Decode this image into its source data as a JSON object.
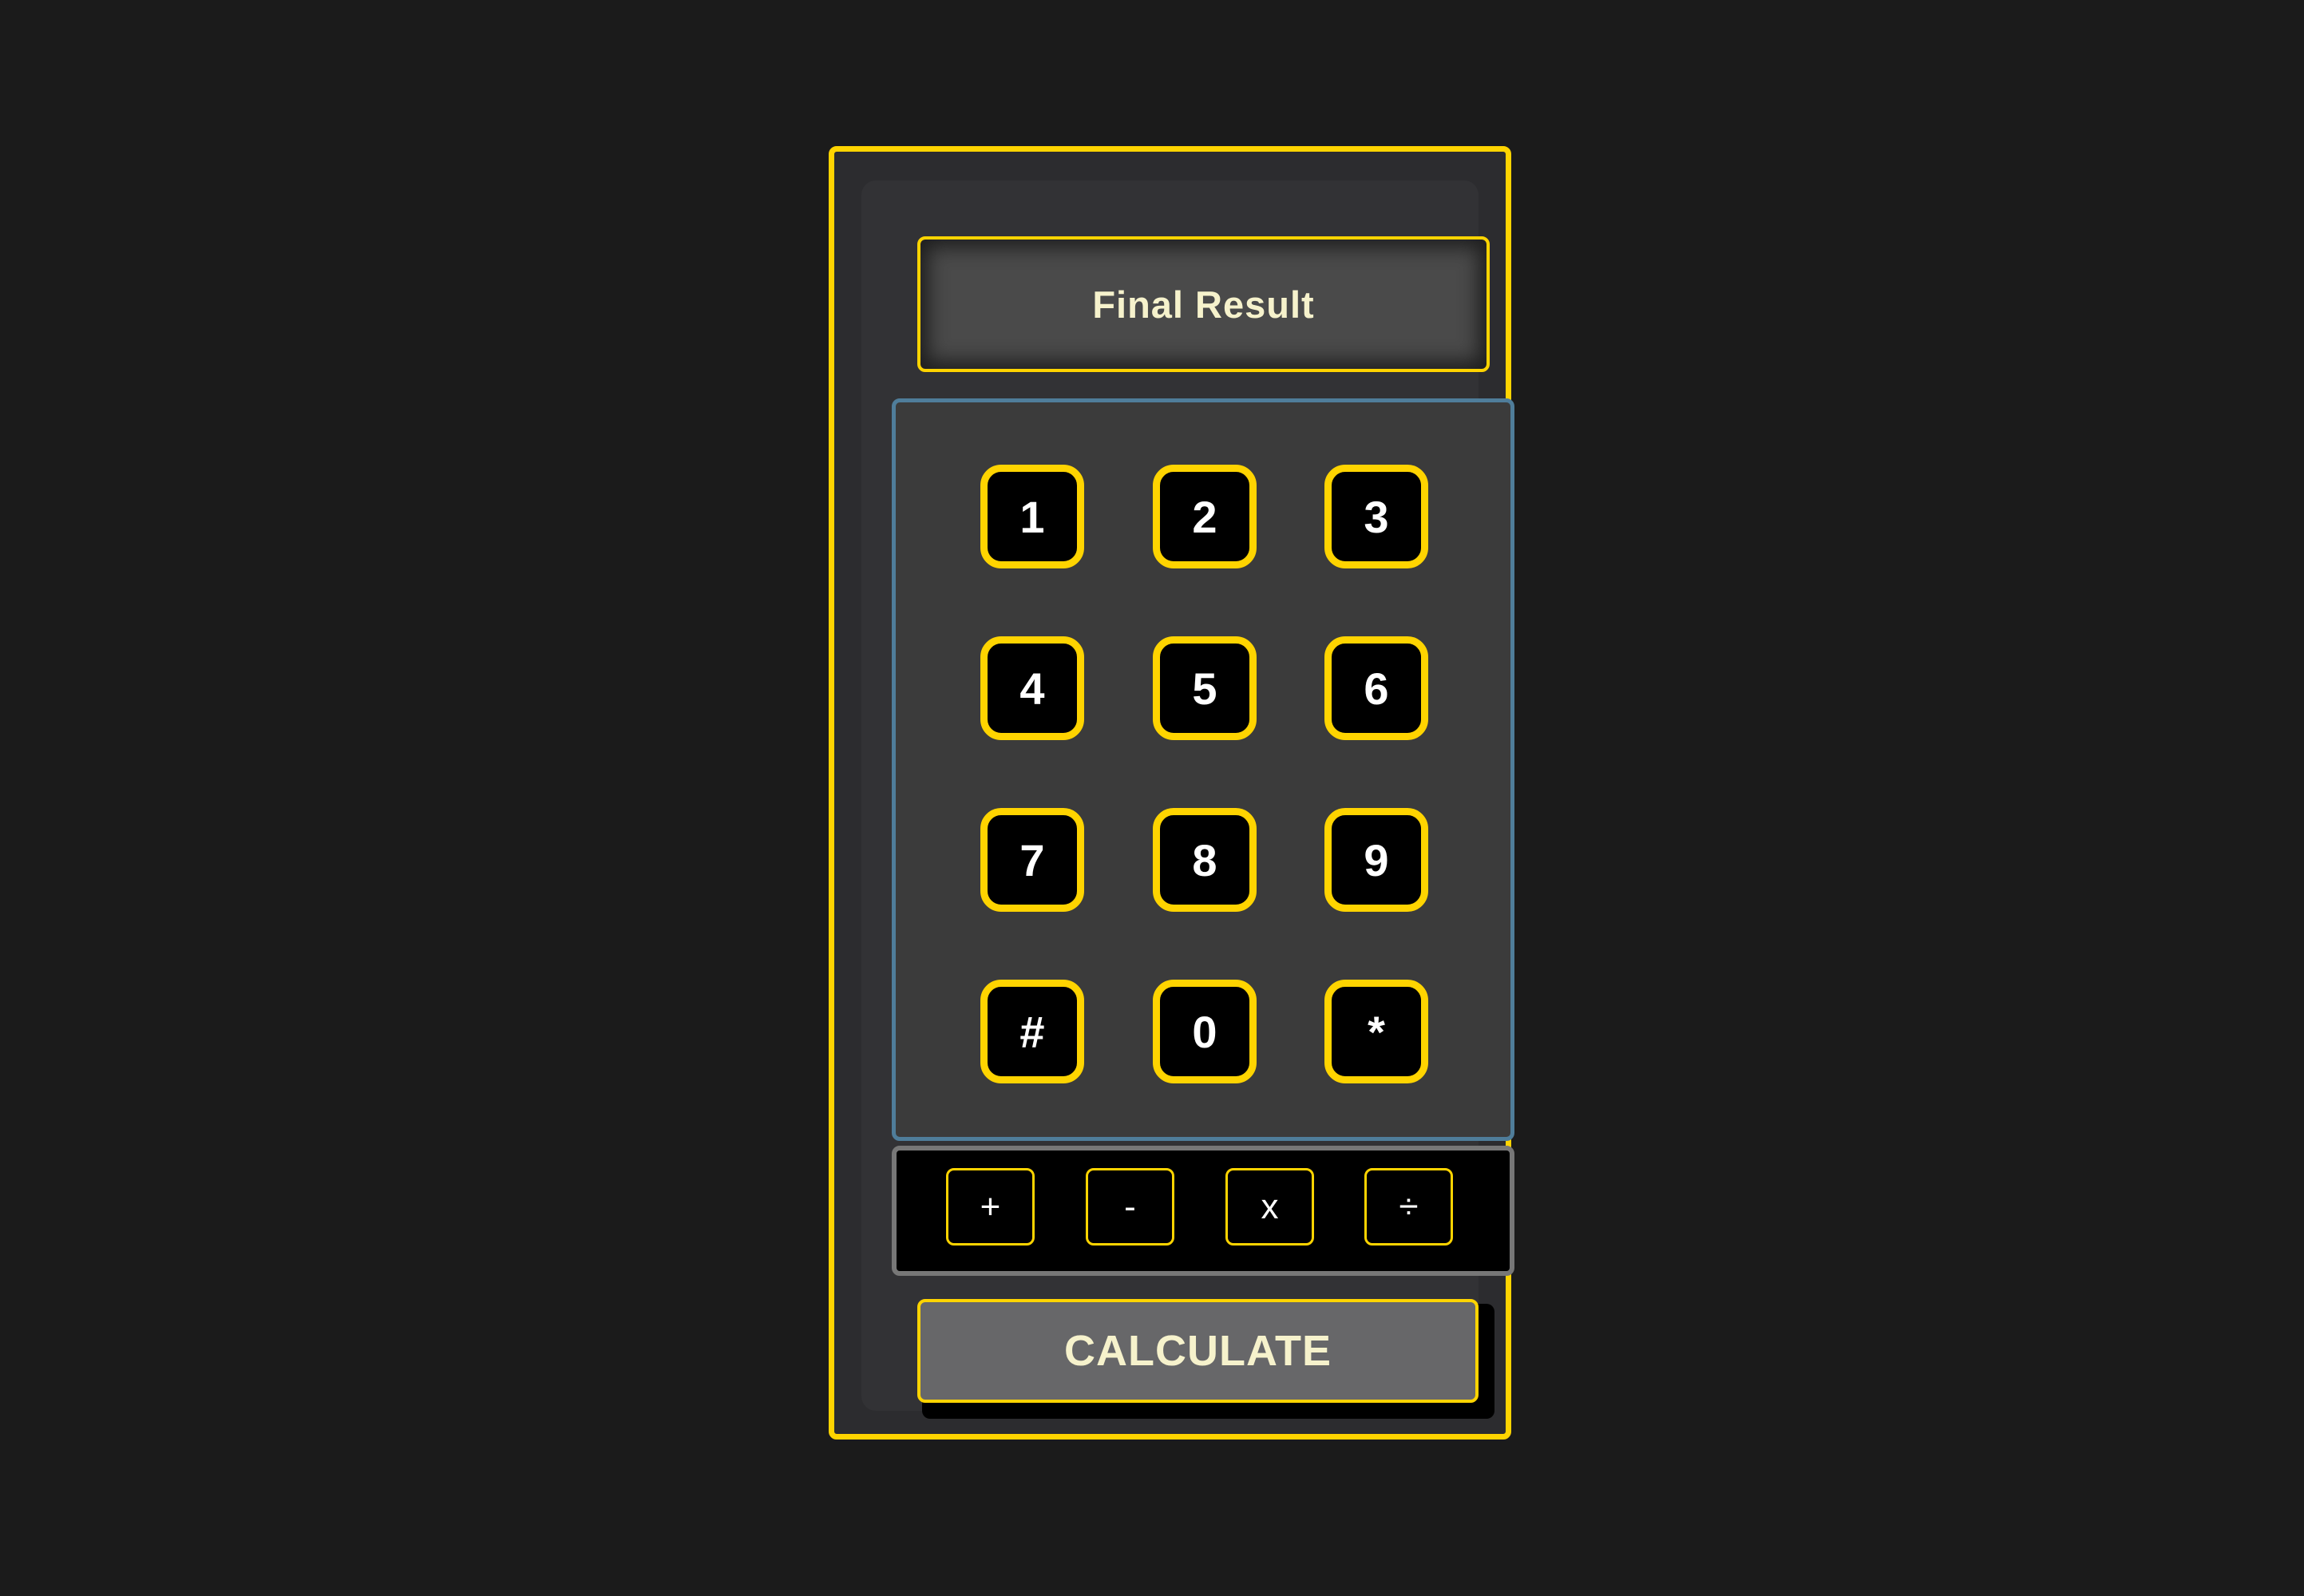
{
  "display": {
    "text": "Final Result"
  },
  "keypad": {
    "keys": [
      "1",
      "2",
      "3",
      "4",
      "5",
      "6",
      "7",
      "8",
      "9",
      "#",
      "0",
      "*"
    ]
  },
  "operators": {
    "plus": "+",
    "minus": "-",
    "multiply": "x",
    "divide": "÷"
  },
  "calculate_button": {
    "label": "CALCULATE"
  },
  "colors": {
    "background": "#1b1b1b",
    "accent": "#ffd400",
    "keypad_border": "#4f7d9a",
    "text_light": "#f6f2cc"
  }
}
